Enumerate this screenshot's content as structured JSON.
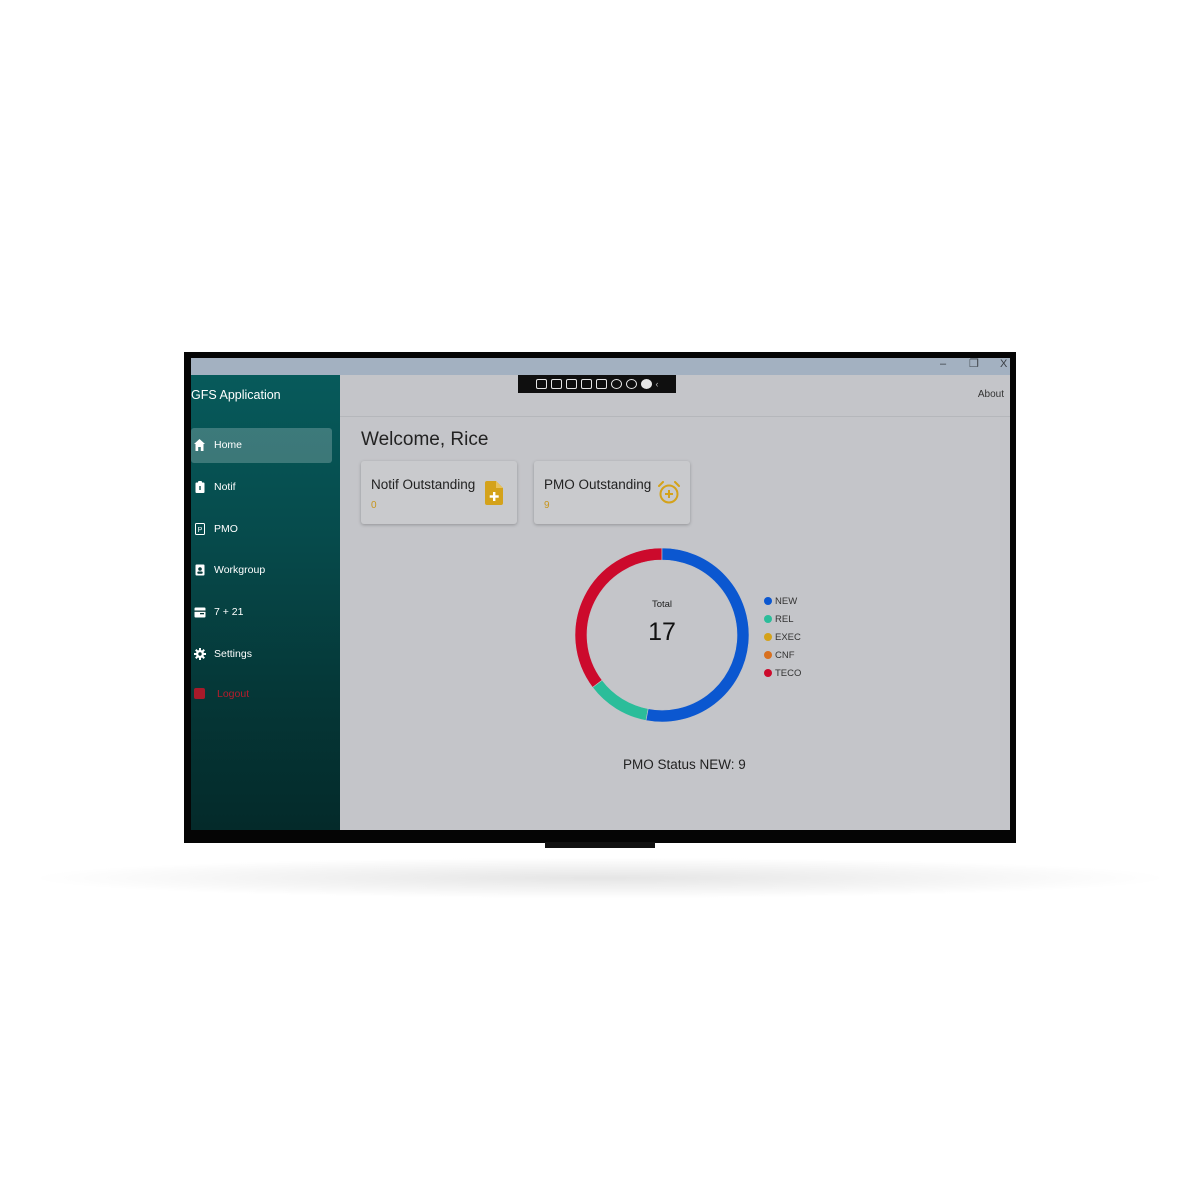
{
  "window": {
    "controls": {
      "minimize": "–",
      "restore": "❐",
      "close": "X"
    }
  },
  "sidebar": {
    "app_title": "GFS Application",
    "items": [
      {
        "label": "Home",
        "icon": "home-icon",
        "active": true
      },
      {
        "label": "Notif",
        "icon": "clipboard-icon",
        "active": false
      },
      {
        "label": "PMO",
        "icon": "pmo-icon",
        "active": false
      },
      {
        "label": "Workgroup",
        "icon": "badge-icon",
        "active": false
      },
      {
        "label": "7 + 21",
        "icon": "calendar-icon",
        "active": false
      },
      {
        "label": "Settings",
        "icon": "gear-icon",
        "active": false
      }
    ],
    "logout_label": "Logout"
  },
  "topbar": {
    "about_label": "About",
    "toolbar_icons": [
      "capture-icon",
      "video-icon",
      "pointer-icon",
      "region-icon",
      "screen-icon",
      "accessibility-icon",
      "person-icon",
      "check-icon"
    ]
  },
  "main": {
    "welcome": "Welcome, Rice",
    "cards": [
      {
        "title": "Notif Outstanding",
        "value": "0",
        "icon": "file-add-icon"
      },
      {
        "title": "PMO Outstanding",
        "value": "9",
        "icon": "alarm-add-icon"
      }
    ],
    "status_text": "PMO Status NEW: 9"
  },
  "chart_data": {
    "type": "pie",
    "variant": "donut",
    "center_label": "Total",
    "center_value": "17",
    "series": [
      {
        "name": "NEW",
        "value": 9,
        "color": "#0b57d0"
      },
      {
        "name": "REL",
        "value": 2,
        "color": "#2bbd9a"
      },
      {
        "name": "EXEC",
        "value": 0,
        "color": "#d4a21a"
      },
      {
        "name": "CNF",
        "value": 0,
        "color": "#d8701f"
      },
      {
        "name": "TECO",
        "value": 6,
        "color": "#cc0a2c"
      }
    ],
    "legend_position": "right"
  },
  "colors": {
    "sidebar_top": "#075a5b",
    "sidebar_bottom": "#042a2a",
    "content_bg": "#c4c5c9",
    "accent_value": "#c8951c",
    "logout": "#b71c2c"
  }
}
